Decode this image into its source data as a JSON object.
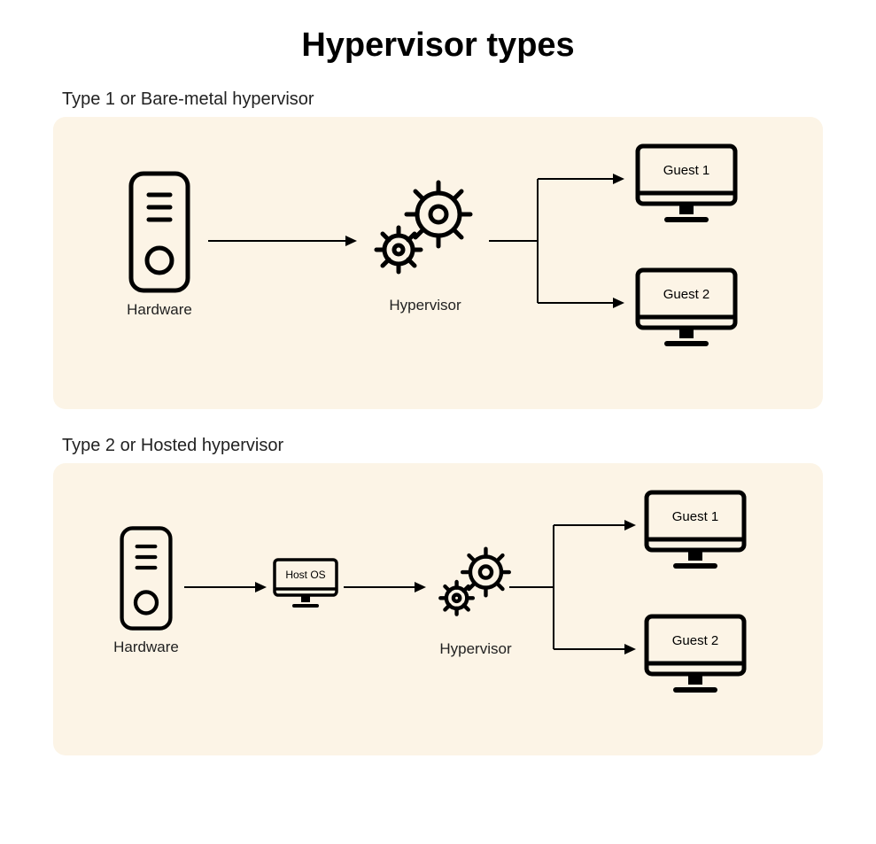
{
  "title": "Hypervisor types",
  "type1": {
    "heading": "Type 1 or Bare-metal hypervisor",
    "hardware_label": "Hardware",
    "hypervisor_label": "Hypervisor",
    "guest1_label": "Guest 1",
    "guest2_label": "Guest 2"
  },
  "type2": {
    "heading": "Type 2 or Hosted hypervisor",
    "hardware_label": "Hardware",
    "hostos_label": "Host OS",
    "hypervisor_label": "Hypervisor",
    "guest1_label": "Guest 1",
    "guest2_label": "Guest 2"
  }
}
